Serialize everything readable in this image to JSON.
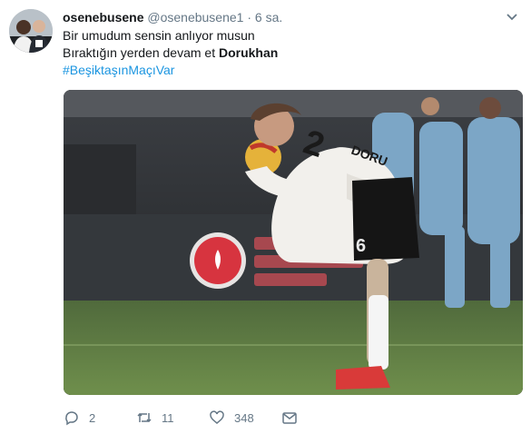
{
  "tweet": {
    "display_name": "osenebusene",
    "handle": "@osenebusene1",
    "separator": "·",
    "time": "6 sa.",
    "line1": "Bir umudum sensin anlıyor musun",
    "line2_prefix": "Bıraktığın yerden devam et ",
    "line2_bold": "Dorukhan",
    "hashtag": "#BeşiktaşınMaçıVar",
    "jersey_number_top": "2",
    "jersey_number_shorts": "6",
    "jersey_name": "DORU",
    "colors": {
      "hashtag": "#1b95e0",
      "meta_gray": "#657786",
      "text": "#14171a"
    }
  },
  "actions": {
    "reply_count": "2",
    "retweet_count": "11",
    "like_count": "348",
    "icons": [
      "reply-icon",
      "retweet-icon",
      "like-icon",
      "direct-message-icon"
    ]
  }
}
